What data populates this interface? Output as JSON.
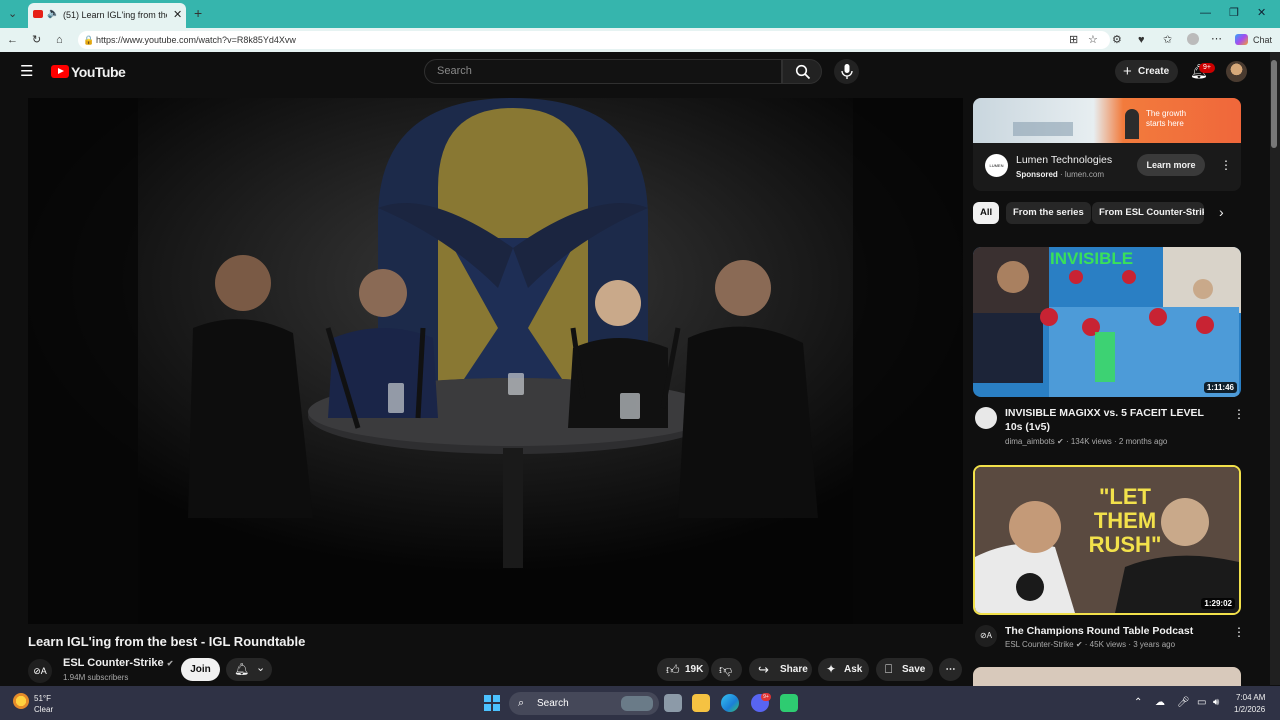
{
  "browser": {
    "tab_title": "(51) Learn IGL'ing from the be",
    "url": "https://www.youtube.com/watch?v=R8k85Yd4Xvw",
    "chat_label": "Chat"
  },
  "yt_header": {
    "logo_text": "YouTube",
    "search_placeholder": "Search",
    "create_label": "Create",
    "notification_count": "9+"
  },
  "video": {
    "title": "Learn IGL'ing from the best - IGL Roundtable",
    "channel": {
      "name": "ESL Counter-Strike",
      "subscribers": "1.94M subscribers",
      "avatar_text": "⊘A"
    },
    "join_label": "Join",
    "likes": "19K",
    "share_label": "Share",
    "ask_label": "Ask",
    "save_label": "Save"
  },
  "ad": {
    "headline": "The growth starts here",
    "advertiser": "Lumen Technologies",
    "sponsored_label": "Sponsored",
    "domain": "lumen.com",
    "logo_text": "LUMEN",
    "cta": "Learn more"
  },
  "chips": [
    "All",
    "From the series",
    "From ESL Counter-Strike"
  ],
  "related": [
    {
      "title": "INVISIBLE MAGIXX vs. 5 FACEIT LEVEL 10s (1v5)",
      "channel": "dima_aimbots",
      "views": "134K views",
      "age": "2 months ago",
      "duration": "1:11:46",
      "thumb_text": "INVISIBLE"
    },
    {
      "title": "The Champions Round Table Podcast",
      "channel": "ESL Counter-Strike",
      "views": "45K views",
      "age": "3 years ago",
      "duration": "1:29:02",
      "thumb_text": "\"LET THEM RUSH\""
    }
  ],
  "taskbar": {
    "weather_temp": "51°F",
    "weather_desc": "Clear",
    "search_label": "Search",
    "time": "7:04 AM",
    "date": "1/2/2026",
    "discord_badge": "9+"
  },
  "colors": {
    "yt_red": "#ff0000",
    "browser_tab": "#36b5ad",
    "taskbar": "#2f3245",
    "thumb_highlight": "#f2e14b"
  }
}
